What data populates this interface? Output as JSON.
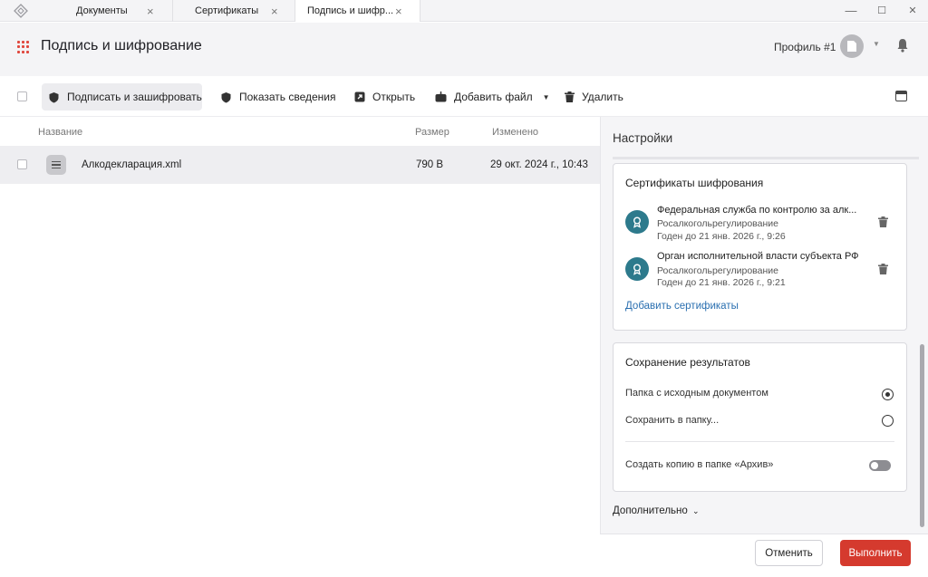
{
  "tabs": [
    {
      "label": "Документы"
    },
    {
      "label": "Сертификаты"
    },
    {
      "label": "Подпись и шифр..."
    }
  ],
  "window_controls": {
    "minimize": "—",
    "maximize": "☐",
    "close": "✕"
  },
  "header": {
    "title": "Подпись и шифрование",
    "profile": "Профиль #1"
  },
  "toolbar": {
    "sign_encrypt": "Подписать и зашифровать",
    "show_info": "Показать сведения",
    "open": "Открыть",
    "add_file": "Добавить файл",
    "delete": "Удалить"
  },
  "table": {
    "columns": {
      "name": "Название",
      "size": "Размер",
      "modified": "Изменено"
    },
    "rows": [
      {
        "name": "Алкодекларация.xml",
        "size": "790 В",
        "modified": "29 окт. 2024 г., 10:43"
      }
    ]
  },
  "settings": {
    "title": "Настройки",
    "encryption_certs": {
      "title": "Сертификаты шифрования",
      "items": [
        {
          "name": "Федеральная служба по контролю за алк...",
          "issuer": "Росалкогольрегулирование",
          "valid_until": "Годен до 21 янв. 2026 г., 9:26"
        },
        {
          "name": "Орган исполнительной власти субъекта РФ",
          "issuer": "Росалкогольрегулирование",
          "valid_until": "Годен до 21 янв. 2026 г., 9:21"
        }
      ],
      "add_link": "Добавить сертификаты"
    },
    "save_results": {
      "title": "Сохранение результатов",
      "option_source_folder": "Папка с исходным документом",
      "option_save_to": "Сохранить в папку...",
      "selected": "Папка с исходным документом",
      "archive_copy_label": "Создать копию в папке «Архив»",
      "archive_copy_enabled": false
    },
    "more_label": "Дополнительно"
  },
  "footer": {
    "cancel": "Отменить",
    "run": "Выполнить"
  },
  "colors": {
    "accent_red": "#d53a2e",
    "cert_badge": "#2d7a8c",
    "link_blue": "#2a6fb0",
    "row_selected": "#eeeef1",
    "header_bg": "#f4f4f6"
  }
}
